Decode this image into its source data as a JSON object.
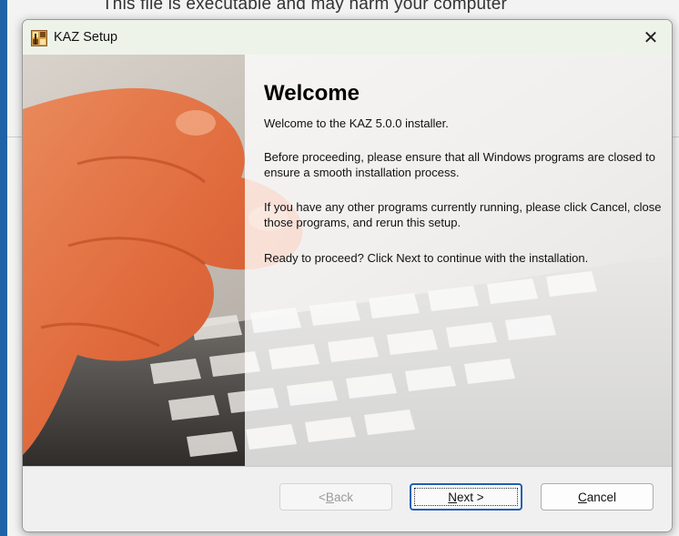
{
  "background": {
    "header_text": "This file is executable and may harm your computer"
  },
  "window": {
    "title": "KAZ Setup",
    "close_glyph": "✕"
  },
  "welcome": {
    "heading": "Welcome",
    "intro": "Welcome to the KAZ 5.0.0 installer.",
    "para1": "Before proceeding, please ensure that all Windows programs are closed to ensure a smooth installation process.",
    "para2": "If you have any other programs currently running, please click Cancel, close those programs, and rerun this setup.",
    "para3": "Ready to proceed? Click Next to continue with the installation."
  },
  "buttons": {
    "back": {
      "prefix": "< ",
      "hotkey": "B",
      "rest": "ack"
    },
    "next": {
      "hotkey": "N",
      "rest": "ext >"
    },
    "cancel": {
      "hotkey": "C",
      "rest": "ancel"
    }
  },
  "icons": [
    "installer-app-icon",
    "close-icon"
  ],
  "colors": {
    "accent": "#1f5fb4",
    "titlebar": "#eef3ea",
    "outer_background": "#2a6fb0"
  }
}
